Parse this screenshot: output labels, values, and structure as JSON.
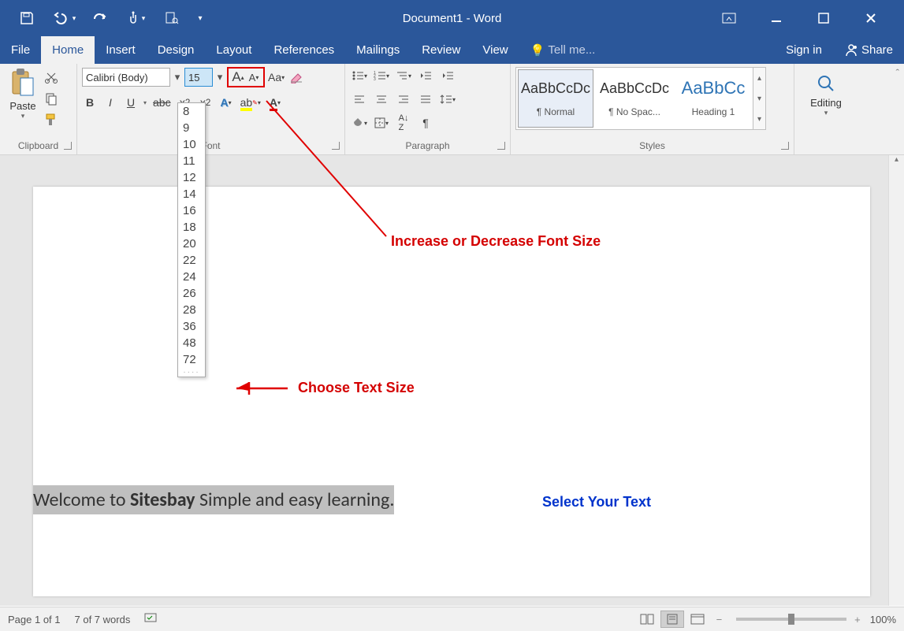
{
  "title": "Document1 - Word",
  "qat_icons": [
    "save-icon",
    "undo-icon",
    "refresh-icon",
    "touch-icon",
    "print-preview-icon",
    "more-icon"
  ],
  "tabs": {
    "file": "File",
    "items": [
      "Home",
      "Insert",
      "Design",
      "Layout",
      "References",
      "Mailings",
      "Review",
      "View"
    ],
    "active": "Home",
    "tell_me": "Tell me...",
    "sign_in": "Sign in",
    "share": "Share"
  },
  "ribbon": {
    "clipboard": {
      "paste": "Paste",
      "label": "Clipboard"
    },
    "font": {
      "font_name": "Calibri (Body)",
      "font_size": "15",
      "label": "Font",
      "bold": "B",
      "italic": "I",
      "underline": "U"
    },
    "paragraph": {
      "label": "Paragraph"
    },
    "styles": {
      "label": "Styles",
      "items": [
        {
          "preview": "AaBbCcDc",
          "name": "¶ Normal",
          "selected": true,
          "color": "#222"
        },
        {
          "preview": "AaBbCcDc",
          "name": "¶ No Spac...",
          "selected": false,
          "color": "#222"
        },
        {
          "preview": "AaBbCc",
          "name": "Heading 1",
          "selected": false,
          "color": "#2e74b5"
        }
      ]
    },
    "editing": {
      "label": "Editing"
    }
  },
  "font_sizes": [
    "8",
    "9",
    "10",
    "11",
    "12",
    "14",
    "16",
    "18",
    "20",
    "22",
    "24",
    "26",
    "28",
    "36",
    "48",
    "72"
  ],
  "annotations": {
    "font_size_hint": "Increase or Decrease Font Size",
    "choose_size": "Choose Text Size",
    "select_text": "Select Your Text"
  },
  "document": {
    "prefix": "Welcome to ",
    "bold": "Sitesbay",
    "suffix": " Simple and easy learning."
  },
  "status": {
    "page": "Page 1 of 1",
    "words": "7 of 7 words",
    "zoom": "100%"
  }
}
